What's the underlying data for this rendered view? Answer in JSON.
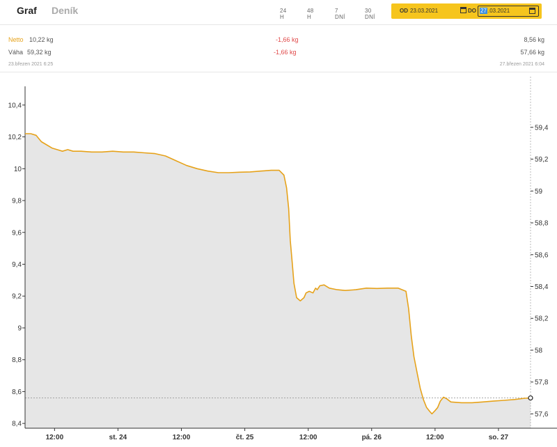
{
  "tabs": [
    {
      "label": "Graf",
      "active": true
    },
    {
      "label": "Deník",
      "active": false
    }
  ],
  "ranges": [
    "24 H",
    "48 H",
    "7 DNÍ",
    "30 DNÍ"
  ],
  "date_filter": {
    "from_label": "OD",
    "from_value": "23.03.2021",
    "to_label": "DO",
    "to_selected": "27",
    "to_rest": ".03.2021"
  },
  "stats": {
    "netto": {
      "label": "Netto",
      "start": "10,22 kg",
      "delta": "-1,66 kg",
      "end": "8,56 kg"
    },
    "vaha": {
      "label": "Váha",
      "start": "59,32 kg",
      "delta": "-1,66 kg",
      "end": "57,66 kg"
    },
    "start_date": "23.březen 2021 6:25",
    "end_date": "27.březen 2021 6:04"
  },
  "colors": {
    "accent": "#e6a21a",
    "negative": "#e04848",
    "fill": "#e6e6e6",
    "date_bg": "#f6c51d"
  },
  "chart_data": {
    "type": "area",
    "x_ticks": [
      "12:00",
      "st. 24",
      "12:00",
      "čt. 25",
      "12:00",
      "pá. 26",
      "12:00",
      "so. 27"
    ],
    "y_left_ticks": [
      "10,4",
      "10,2",
      "10",
      "9,8",
      "9,6",
      "9,4",
      "9,2",
      "9",
      "8,8",
      "8,6",
      "8,4"
    ],
    "y_right_ticks": [
      "59,4",
      "59,2",
      "59",
      "58,8",
      "58,6",
      "58,4",
      "58,2",
      "58",
      "57,8",
      "57,6"
    ],
    "ylim_left": [
      8.37,
      10.5
    ],
    "ylim_right": [
      57.51,
      59.64
    ],
    "x_unit": "hours since 23.03. 00:00",
    "xlim": [
      6.42,
      102.07
    ],
    "series": [
      {
        "name": "Netto",
        "points": [
          [
            6.42,
            10.22
          ],
          [
            7.5,
            10.22
          ],
          [
            8.5,
            10.21
          ],
          [
            9.5,
            10.17
          ],
          [
            10.5,
            10.15
          ],
          [
            11.5,
            10.13
          ],
          [
            12.5,
            10.12
          ],
          [
            13.5,
            10.11
          ],
          [
            14.5,
            10.12
          ],
          [
            15.5,
            10.11
          ],
          [
            17,
            10.11
          ],
          [
            19,
            10.105
          ],
          [
            21,
            10.105
          ],
          [
            23,
            10.11
          ],
          [
            25,
            10.105
          ],
          [
            27,
            10.105
          ],
          [
            29,
            10.1
          ],
          [
            31,
            10.095
          ],
          [
            33,
            10.08
          ],
          [
            35,
            10.05
          ],
          [
            37,
            10.02
          ],
          [
            39,
            10.0
          ],
          [
            41,
            9.985
          ],
          [
            43,
            9.975
          ],
          [
            45,
            9.975
          ],
          [
            47,
            9.978
          ],
          [
            49,
            9.98
          ],
          [
            51,
            9.985
          ],
          [
            53,
            9.99
          ],
          [
            54.5,
            9.99
          ],
          [
            55.4,
            9.96
          ],
          [
            55.9,
            9.88
          ],
          [
            56.3,
            9.75
          ],
          [
            56.6,
            9.55
          ],
          [
            57.0,
            9.4
          ],
          [
            57.3,
            9.28
          ],
          [
            57.8,
            9.19
          ],
          [
            58.5,
            9.17
          ],
          [
            59.2,
            9.19
          ],
          [
            59.6,
            9.22
          ],
          [
            60.2,
            9.23
          ],
          [
            60.9,
            9.22
          ],
          [
            61.4,
            9.25
          ],
          [
            61.7,
            9.24
          ],
          [
            62.2,
            9.265
          ],
          [
            63.0,
            9.27
          ],
          [
            64,
            9.25
          ],
          [
            65.5,
            9.24
          ],
          [
            67,
            9.235
          ],
          [
            69,
            9.24
          ],
          [
            71,
            9.25
          ],
          [
            73,
            9.248
          ],
          [
            75,
            9.25
          ],
          [
            77,
            9.25
          ],
          [
            78.5,
            9.23
          ],
          [
            79.0,
            9.12
          ],
          [
            79.5,
            8.95
          ],
          [
            80.0,
            8.82
          ],
          [
            80.6,
            8.72
          ],
          [
            81.2,
            8.62
          ],
          [
            81.8,
            8.55
          ],
          [
            82.4,
            8.5
          ],
          [
            83.0,
            8.475
          ],
          [
            83.4,
            8.46
          ],
          [
            84.0,
            8.48
          ],
          [
            84.5,
            8.5
          ],
          [
            85.0,
            8.54
          ],
          [
            85.6,
            8.565
          ],
          [
            86.2,
            8.555
          ],
          [
            87.0,
            8.535
          ],
          [
            89,
            8.53
          ],
          [
            91,
            8.53
          ],
          [
            93,
            8.535
          ],
          [
            95,
            8.54
          ],
          [
            97,
            8.545
          ],
          [
            99,
            8.55
          ],
          [
            101,
            8.558
          ],
          [
            102.07,
            8.56
          ]
        ]
      }
    ],
    "reference_value": 8.56
  }
}
